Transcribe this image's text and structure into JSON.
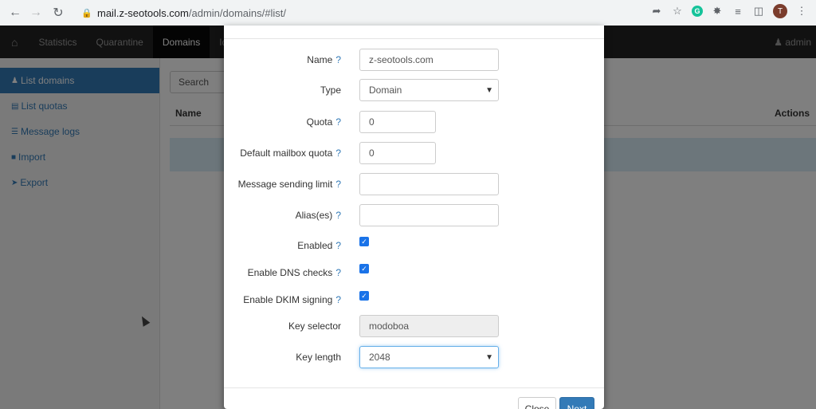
{
  "browser": {
    "url_host": "mail.z-seotools.com",
    "url_path": "/admin/domains/#list/",
    "extension_letter": "G",
    "profile_letter": "T"
  },
  "appnav": {
    "items": [
      {
        "label": "Statistics"
      },
      {
        "label": "Quarantine"
      },
      {
        "label": "Domains"
      },
      {
        "label": "Ide"
      }
    ],
    "user_label": "admin"
  },
  "sidebar": {
    "items": [
      {
        "label": "List domains"
      },
      {
        "label": "List quotas"
      },
      {
        "label": "Message logs"
      },
      {
        "label": "Import"
      },
      {
        "label": "Export"
      }
    ]
  },
  "main": {
    "search_placeholder": "Search",
    "col_name": "Name",
    "col_actions": "Actions"
  },
  "form": {
    "name": {
      "label": "Name",
      "value": "z-seotools.com"
    },
    "type": {
      "label": "Type",
      "value": "Domain"
    },
    "quota": {
      "label": "Quota",
      "value": "0"
    },
    "default_mailbox_quota": {
      "label": "Default mailbox quota",
      "value": "0"
    },
    "message_sending_limit": {
      "label": "Message sending limit",
      "value": ""
    },
    "aliases": {
      "label": "Alias(es)",
      "value": ""
    },
    "enabled": {
      "label": "Enabled",
      "checked": true
    },
    "enable_dns_checks": {
      "label": "Enable DNS checks",
      "checked": true
    },
    "enable_dkim_signing": {
      "label": "Enable DKIM signing",
      "checked": true
    },
    "key_selector": {
      "label": "Key selector",
      "value": "modoboa"
    },
    "key_length": {
      "label": "Key length",
      "value": "2048"
    },
    "help_mark": "?"
  },
  "buttons": {
    "close": "Close",
    "next": "Next"
  },
  "colors": {
    "accent": "#337ab7",
    "navbar": "#222222",
    "checkbox": "#1a73e8"
  }
}
